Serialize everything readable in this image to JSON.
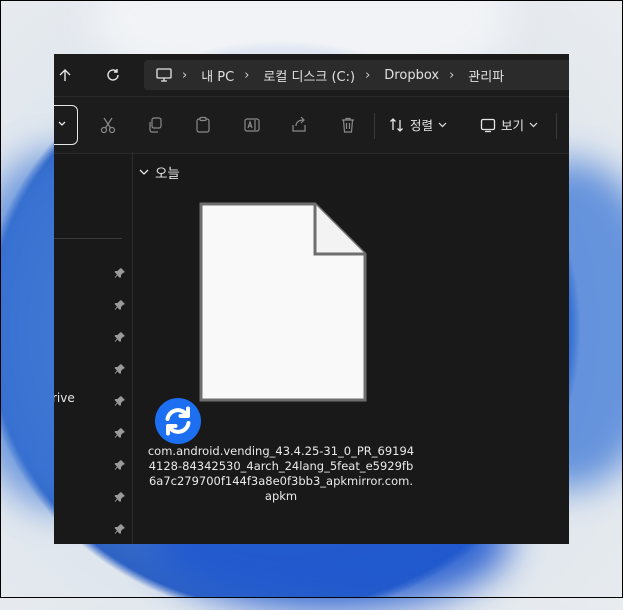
{
  "breadcrumb": [
    "내 PC",
    "로컬 디스크 (C:)",
    "Dropbox",
    "관리파"
  ],
  "toolbar": {
    "sort_label": "정렬",
    "view_label": "보기"
  },
  "sidebar": {
    "partial_label": "rive"
  },
  "group": {
    "label": "오늘"
  },
  "file": {
    "name": "com.android.vending_43.4.25-31_0_PR_691944128-84342530_4arch_24lang_5feat_e5929fb6a7c279700f144f3a8e0f3bb3_apkmirror.com.apkm",
    "status_icon": "sync-icon"
  },
  "colors": {
    "accent": "#1d6ff2",
    "window_bg": "#191919"
  }
}
